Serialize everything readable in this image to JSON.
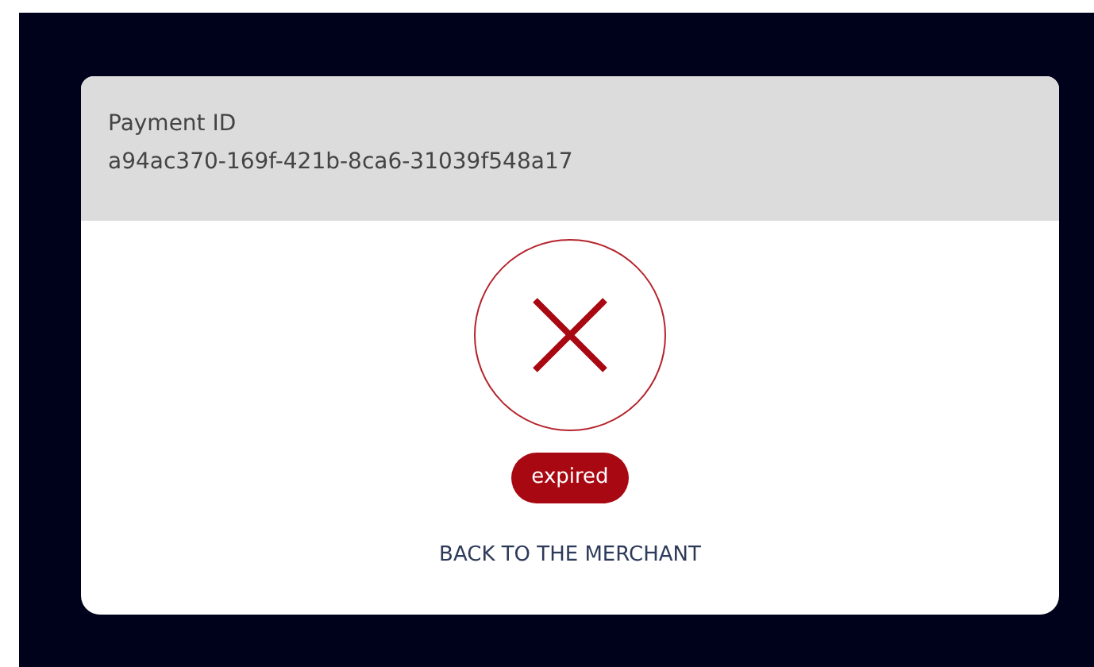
{
  "payment": {
    "label": "Payment ID",
    "id": "a94ac370-169f-421b-8ca6-31039f548a17"
  },
  "status": {
    "kind": "failed",
    "label": "expired"
  },
  "link": "BACK TO THE MERCHANT"
}
